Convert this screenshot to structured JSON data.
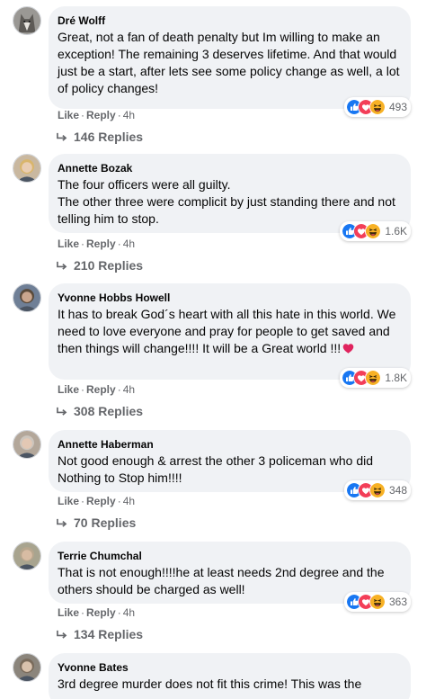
{
  "comments": [
    {
      "author": "Dré Wolff",
      "lines": [
        "Great, not a fan of death penalty but Im willing to make an exception! The remaining 3 deserves lifetime. And that would just be a start, after lets see some policy change as well, a lot of policy changes!"
      ],
      "reaction_count": "493",
      "reactions": [
        "like",
        "love",
        "haha"
      ],
      "like": "Like",
      "reply": "Reply",
      "time": "4h",
      "replies": "146 Replies",
      "avatar": "wolf-avatar"
    },
    {
      "author": "Annette Bozak",
      "lines": [
        "The four officers were all guilty.",
        "The other three were complicit by just standing there and not telling him to stop."
      ],
      "reaction_count": "1.6K",
      "reactions": [
        "like",
        "love",
        "haha"
      ],
      "like": "Like",
      "reply": "Reply",
      "time": "4h",
      "replies": "210 Replies",
      "avatar": "person-avatar"
    },
    {
      "author": "Yvonne Hobbs Howell",
      "lines": [
        "It has to break God´s heart with all this hate in this world. We need to love everyone and pray for people to get saved and then things will change!!!! It will be a Great world !!!"
      ],
      "has_heart": true,
      "reaction_count": "1.8K",
      "reactions": [
        "like",
        "love",
        "haha"
      ],
      "like": "Like",
      "reply": "Reply",
      "time": "4h",
      "replies": "308 Replies",
      "avatar": "person-avatar"
    },
    {
      "author": "Annette Haberman",
      "lines": [
        "Not good enough & arrest the other 3 policeman who did Nothing to Stop him!!!!"
      ],
      "reaction_count": "348",
      "reactions": [
        "like",
        "love",
        "haha"
      ],
      "like": "Like",
      "reply": "Reply",
      "time": "4h",
      "replies": "70 Replies",
      "avatar": "person-avatar"
    },
    {
      "author": "Terrie Chumchal",
      "lines": [
        "That is not enough!!!!he at least needs 2nd degree and the others should be charged as well!"
      ],
      "reaction_count": "363",
      "reactions": [
        "like",
        "love",
        "haha"
      ],
      "like": "Like",
      "reply": "Reply",
      "time": "4h",
      "replies": "134 Replies",
      "avatar": "person-avatar"
    },
    {
      "author": "Yvonne Bates",
      "lines": [
        "3rd degree murder does not fit this crime! This was the"
      ],
      "reaction_count": "",
      "reactions": [],
      "like": "",
      "reply": "",
      "time": "",
      "replies": "",
      "avatar": "person-avatar"
    }
  ],
  "colors": {
    "bubble": "#f0f2f5",
    "meta": "#65676b",
    "like_blue": "#1877f2",
    "love_red": "#f33e58",
    "haha_yellow": "#f7b125"
  }
}
